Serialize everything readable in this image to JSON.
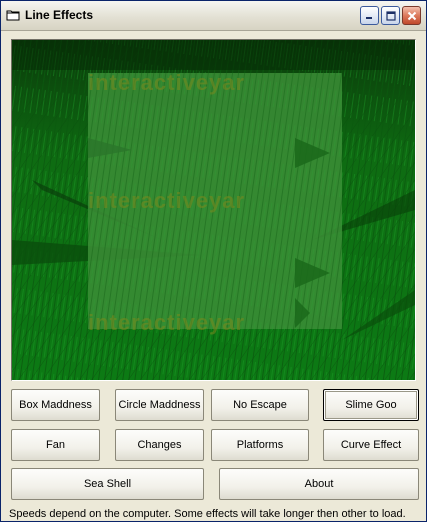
{
  "window": {
    "title": "Line Effects",
    "icon": "folder-icon",
    "controls": [
      "minimize-icon",
      "maximize-icon",
      "close-icon"
    ]
  },
  "canvas": {
    "background_color": "#0b7a16",
    "watermark_text": "interactiveyar"
  },
  "buttons": {
    "box_maddness": "Box Maddness",
    "circle_maddness": "Circle Maddness",
    "no_escape": "No Escape",
    "slime_goo": "Slime Goo",
    "fan": "Fan",
    "changes": "Changes",
    "platforms": "Platforms",
    "curve_effect": "Curve Effect",
    "sea_shell": "Sea Shell",
    "about": "About"
  },
  "status": {
    "text": "Speeds depend on the computer. Some effects will take longer then other to load."
  }
}
